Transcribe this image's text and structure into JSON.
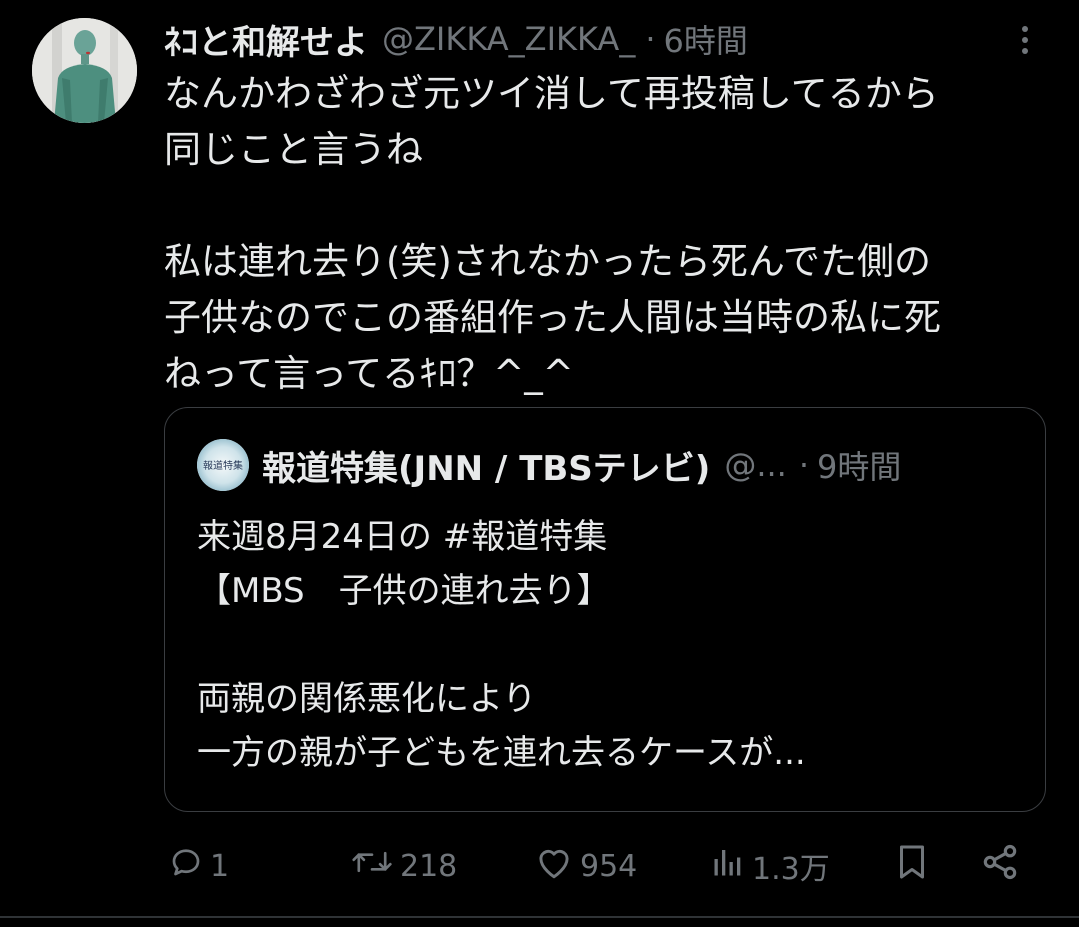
{
  "tweet": {
    "display_name": "ﾈｺと和解せよ",
    "handle": "@ZIKKA_ZIKKA_",
    "separator": "·",
    "time": "6時間",
    "lines": [
      "なんかわざわざ元ツイ消して再投稿してるから",
      "同じこと言うね",
      "",
      "私は連れ去り(笑)されなかったら死んでた側の",
      "子供なのでこの番組作った人間は当時の私に死",
      "ねって言ってるｷﾛ？^_^"
    ]
  },
  "quote": {
    "display_name": "報道特集(JNN / TBSテレビ)",
    "handle": "@...",
    "separator": "·",
    "time": "9時間",
    "avatar_text": "報道特集",
    "lines": [
      "来週8月24日の #報道特集",
      "【MBS　子供の連れ去り】",
      "",
      "両親の関係悪化により",
      "一方の親が子どもを連れ去るケースが..."
    ]
  },
  "actions": {
    "replies": "1",
    "retweets": "218",
    "likes": "954",
    "views": "1.3万"
  },
  "icons": {
    "more": "more-vertical-icon",
    "reply": "reply-icon",
    "retweet": "retweet-icon",
    "like": "heart-icon",
    "views": "views-chart-icon",
    "bookmark": "bookmark-icon",
    "share": "share-icon"
  },
  "colors": {
    "background": "#000000",
    "text": "#e7e9ea",
    "secondary": "#71767b",
    "border": "#3a3d41"
  }
}
